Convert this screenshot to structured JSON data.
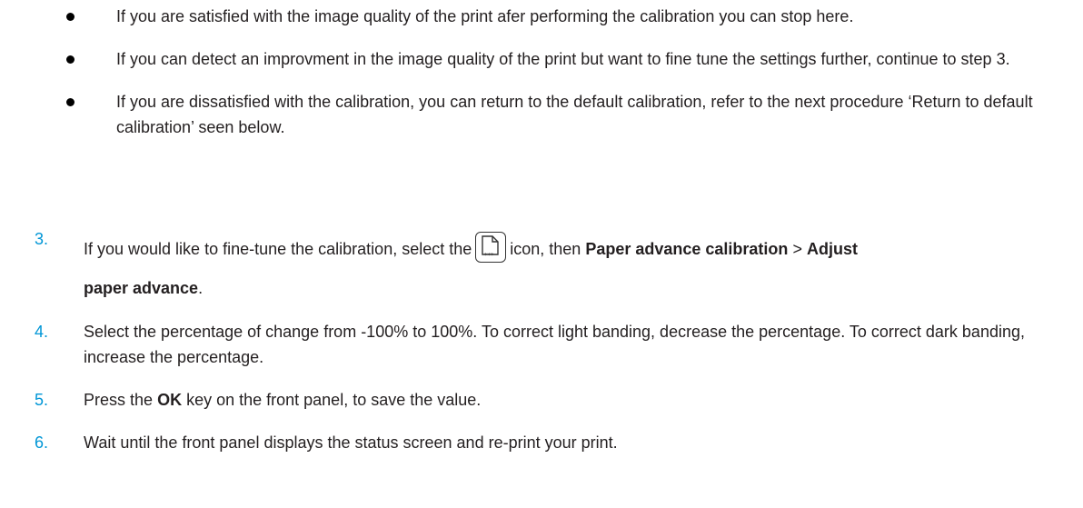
{
  "bullets": [
    "If you are satisfied with the image quality of the print afer performing the calibration you can stop here.",
    "If you can detect an improvment in the image quality of the print but want to fine tune the settings further, continue to step 3.",
    "If you are dissatisfied with the calibration, you can return to the default calibration, refer to the next procedure ‘Return to default calibration’ seen below."
  ],
  "steps": {
    "s3": {
      "number": "3.",
      "text_a": "If you would like to fine-tune the calibration, select the",
      "icon": "paper-settings-icon",
      "text_b": "icon, then",
      "menu_1": "Paper advance calibration",
      "sep": ">",
      "menu_2": "Adjust paper advance",
      "end": "."
    },
    "s4": {
      "number": "4.",
      "text": "Select the percentage of change from -100% to 100%. To correct light banding, decrease the percentage. To correct dark banding, increase the percentage."
    },
    "s5": {
      "number": "5.",
      "text_a": "Press the",
      "key": "OK",
      "text_b": "key on the front panel, to save the value."
    },
    "s6": {
      "number": "6.",
      "text": "Wait until the front panel displays the status screen and re-print your print."
    }
  },
  "colors": {
    "step_number": "#0096d6",
    "text": "#231f20"
  }
}
